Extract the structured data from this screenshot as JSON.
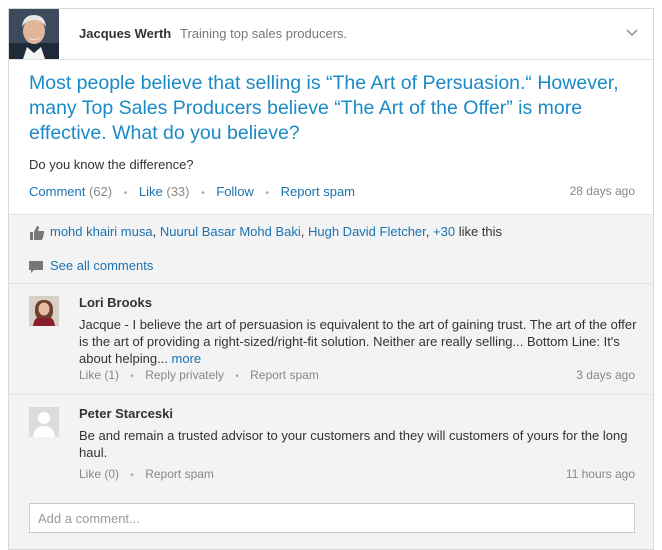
{
  "post": {
    "author": "Jacques Werth",
    "headline": "Training top sales producers.",
    "title": "Most people believe that selling is “The Art of Persuasion.“ However, many Top Sales Producers believe “The Art of the Offer” is more effective. What do you believe?",
    "question": "Do you know the difference?",
    "actions": {
      "comment_label": "Comment",
      "comment_count": "(62)",
      "like_label": "Like",
      "like_count": "(33)",
      "follow_label": "Follow",
      "report_label": "Report spam"
    },
    "time": "28 days ago"
  },
  "likes": {
    "names": [
      "mohd khairi musa",
      "Nuurul Basar Mohd Baki",
      "Hugh David Fletcher"
    ],
    "more": "+30",
    "suffix": "like this"
  },
  "see_all": "See all comments",
  "comments": [
    {
      "name": "Lori Brooks",
      "body": "Jacque - I believe the art of persuasion is equivalent to the art of gaining trust. The art of the offer is the art of providing a right-sized/right-fit solution. Neither are really selling... Bottom Line: It's about helping...",
      "more": "more",
      "like": "Like (1)",
      "reply": "Reply privately",
      "report": "Report spam",
      "time": "3 days ago"
    },
    {
      "name": "Peter Starceski",
      "body": "Be and remain a trusted advisor to your customers and they will customers of yours for the long haul.",
      "like": "Like (0)",
      "report": "Report spam",
      "time": "11 hours ago"
    }
  ],
  "add_comment": {
    "placeholder": "Add a comment..."
  },
  "icons": {
    "chevron": "chevron-down-icon",
    "thumb": "thumbs-up-icon",
    "bubble": "speech-bubble-icon"
  },
  "colors": {
    "link": "#1a73b0",
    "title": "#1a8ac6",
    "muted": "#888888",
    "panel": "#f3f3f3"
  }
}
